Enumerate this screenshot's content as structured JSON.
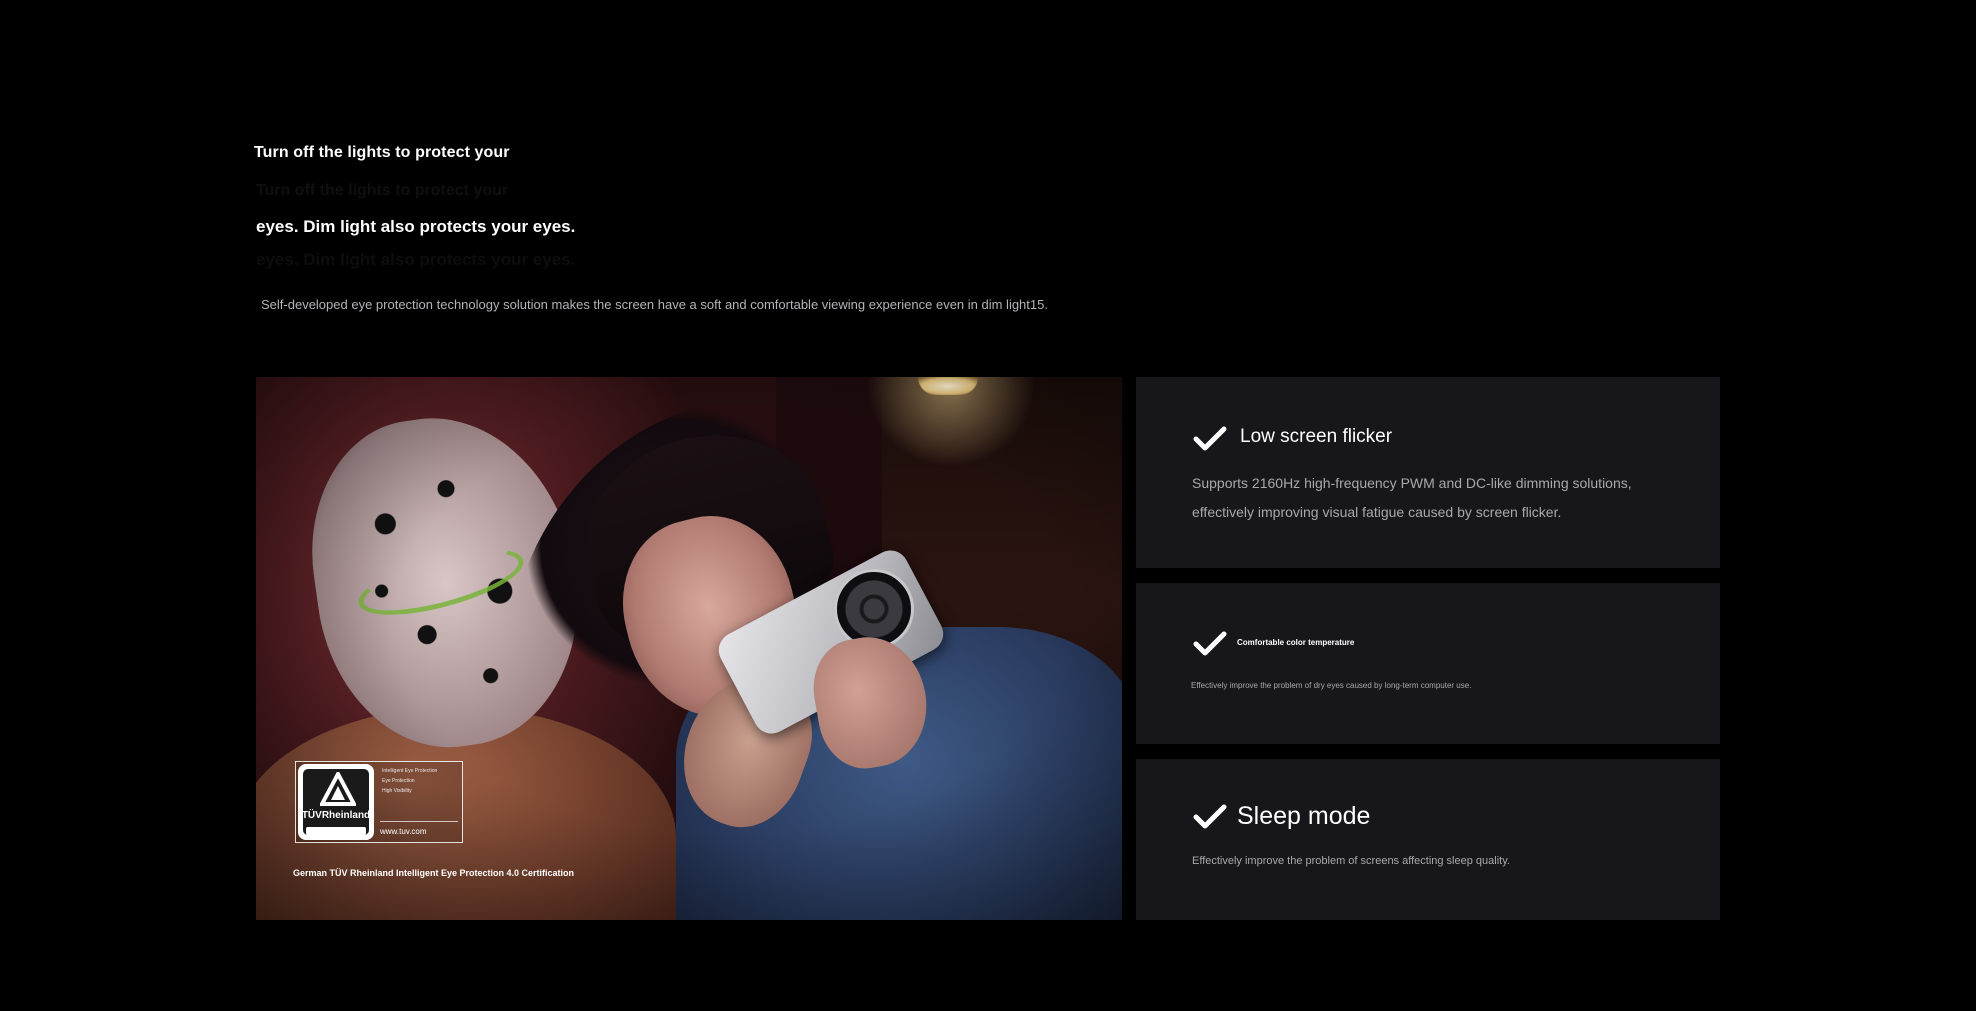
{
  "header": {
    "headline_line1": "Turn off the lights to protect your",
    "headline_line2": "eyes. Dim light also protects your eyes.",
    "subtitle": "Self-developed eye protection technology solution makes the screen have a soft and comfortable viewing experience even in dim light15."
  },
  "hero": {
    "certification": {
      "logo_text": "TÜVRheinland",
      "label_lines": [
        "Intelligent Eye Protection",
        "Eye Protection",
        "High Visibility"
      ],
      "url": "www.tuv.com",
      "caption": "German TÜV Rheinland Intelligent Eye Protection 4.0 Certification"
    }
  },
  "features": [
    {
      "icon": "check-icon",
      "title": "Low screen flicker",
      "description": "Supports 2160Hz high-frequency PWM and DC-like dimming solutions, effectively improving visual fatigue caused by screen flicker."
    },
    {
      "icon": "check-icon",
      "title": "Comfortable color temperature",
      "description": "Effectively improve the problem of dry eyes caused by long-term computer use."
    },
    {
      "icon": "check-icon",
      "title": "Sleep mode",
      "description": "Effectively improve the problem of screens affecting sleep quality."
    }
  ],
  "colors": {
    "background": "#000000",
    "card_background": "#16161b",
    "check_mark": "#ffffff",
    "muted_text": "#a8a8ae"
  }
}
